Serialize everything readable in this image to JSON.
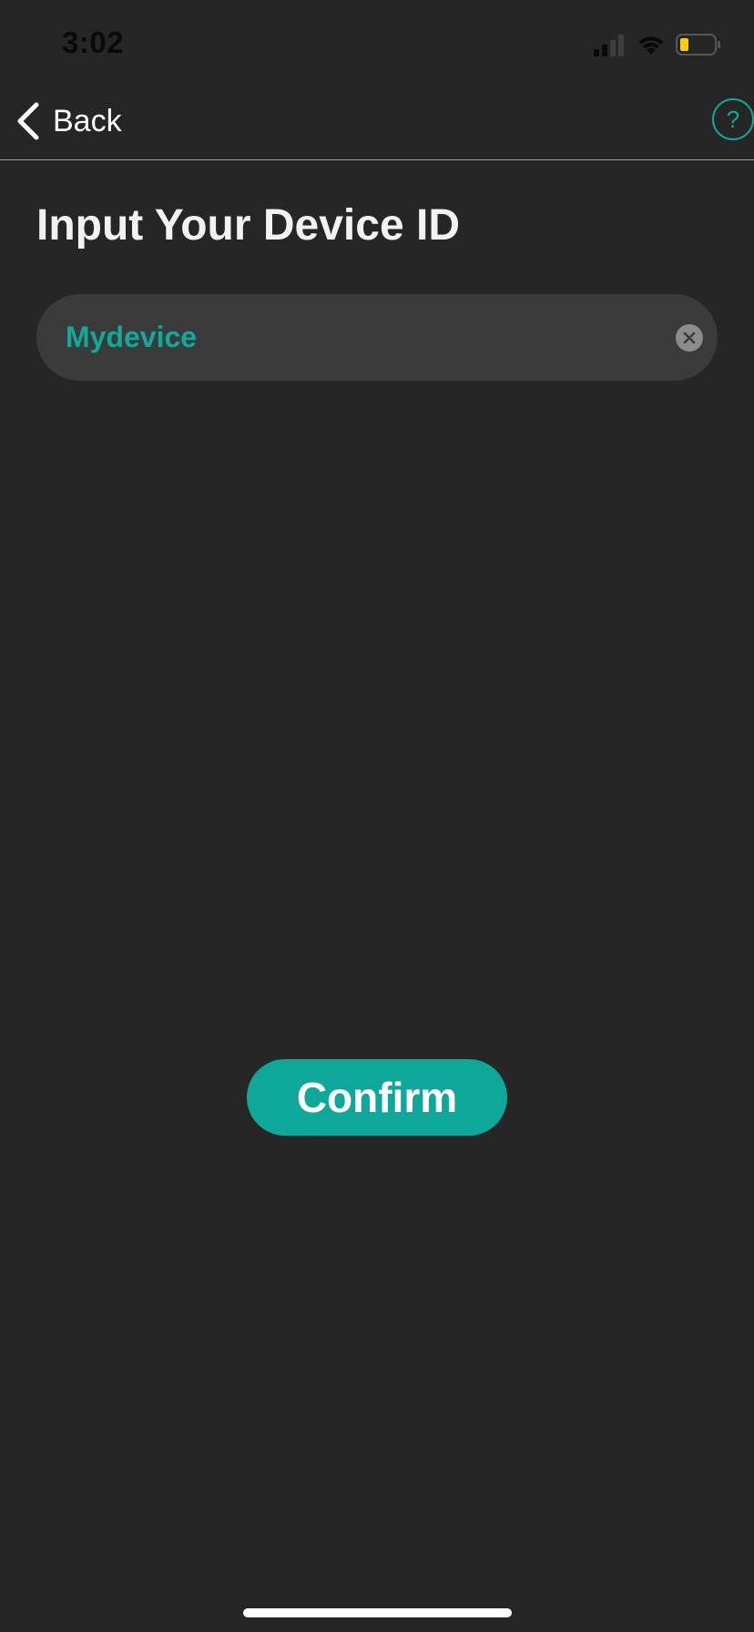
{
  "status_bar": {
    "time": "3:02",
    "signal_icon": "cellular-signal-icon",
    "wifi_icon": "wifi-icon",
    "battery_icon": "battery-low-icon",
    "battery_color": "#ffcc00"
  },
  "nav": {
    "back_label": "Back",
    "back_icon": "chevron-left-icon",
    "help_label": "?",
    "help_icon": "help-circle-icon"
  },
  "page": {
    "title": "Input Your Device ID"
  },
  "device_input": {
    "value": "Mydevice",
    "clear_icon": "clear-x-icon"
  },
  "actions": {
    "confirm_label": "Confirm"
  },
  "colors": {
    "background": "#262626",
    "accent": "#13a89a",
    "input_background": "#3b3b3b"
  }
}
